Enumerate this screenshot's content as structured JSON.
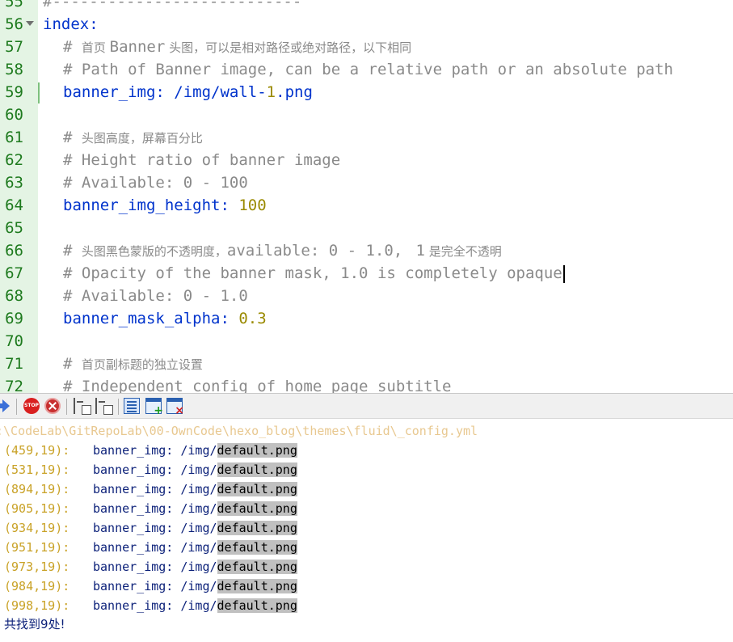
{
  "editor": {
    "lines": [
      {
        "num": "55",
        "kind": "plain",
        "text": "#---------------------------"
      },
      {
        "num": "56",
        "kind": "section",
        "text": "index:",
        "fold": true
      },
      {
        "num": "57",
        "kind": "comment",
        "prefix": "# ",
        "parts": [
          {
            "t": "首页 ",
            "cjk": true
          },
          {
            "t": "Banner",
            "cjk": false
          },
          {
            "t": " 头图，可以是相对路径或绝对路径，以下相同",
            "cjk": true
          }
        ]
      },
      {
        "num": "58",
        "kind": "comment",
        "prefix": "# ",
        "parts": [
          {
            "t": "Path of Banner image, can be a relative path or an absolute path",
            "cjk": false
          }
        ]
      },
      {
        "num": "59",
        "kind": "kv",
        "key": "banner_img",
        "value": "/img/wall-",
        "num_value": "1",
        "suffix": ".png"
      },
      {
        "num": "60",
        "kind": "blank"
      },
      {
        "num": "61",
        "kind": "comment",
        "prefix": "# ",
        "parts": [
          {
            "t": "头图高度，屏幕百分比",
            "cjk": true
          }
        ]
      },
      {
        "num": "62",
        "kind": "comment",
        "prefix": "# ",
        "parts": [
          {
            "t": "Height ratio of banner image",
            "cjk": false
          }
        ]
      },
      {
        "num": "63",
        "kind": "comment",
        "prefix": "# ",
        "parts": [
          {
            "t": "Available: 0 - 100",
            "cjk": false
          }
        ]
      },
      {
        "num": "64",
        "kind": "kv",
        "key": "banner_img_height",
        "value": "",
        "num_value": "100",
        "suffix": ""
      },
      {
        "num": "65",
        "kind": "blank"
      },
      {
        "num": "66",
        "kind": "comment",
        "prefix": "# ",
        "parts": [
          {
            "t": "头图黑色蒙版的不透明度，",
            "cjk": true
          },
          {
            "t": "available: 0 - 1.0, ",
            "cjk": false
          },
          {
            "t": " ",
            "cjk": true
          },
          {
            "t": "1",
            "cjk": false
          },
          {
            "t": " 是完全不透明",
            "cjk": true
          }
        ]
      },
      {
        "num": "67",
        "kind": "comment",
        "prefix": "# ",
        "caret": true,
        "parts": [
          {
            "t": "Opacity of the banner mask, 1.0 is completely opaque",
            "cjk": false
          }
        ]
      },
      {
        "num": "68",
        "kind": "comment",
        "prefix": "# ",
        "parts": [
          {
            "t": "Available: 0 - 1.0",
            "cjk": false
          }
        ]
      },
      {
        "num": "69",
        "kind": "kv",
        "key": "banner_mask_alpha",
        "value": "",
        "num_value": "0.3",
        "suffix": ""
      },
      {
        "num": "70",
        "kind": "blank"
      },
      {
        "num": "71",
        "kind": "comment",
        "prefix": "# ",
        "parts": [
          {
            "t": "首页副标题的独立设置",
            "cjk": true
          }
        ]
      },
      {
        "num": "72",
        "kind": "comment",
        "prefix": "# ",
        "parts": [
          {
            "t": "Independent config of home page subtitle",
            "cjk": false
          }
        ]
      }
    ]
  },
  "toolbar": {
    "buttons": [
      {
        "name": "goto-result-button",
        "icon": "arrow-icon"
      },
      {
        "name": "stop-search-button",
        "icon": "stop-icon",
        "label": "STOP"
      },
      {
        "name": "clear-results-button",
        "icon": "close-circle-icon"
      },
      {
        "name": "collapse-all-button",
        "icon": "collapse-tree-icon"
      },
      {
        "name": "expand-all-button",
        "icon": "expand-tree-icon"
      },
      {
        "name": "word-wrap-button",
        "icon": "list-icon"
      },
      {
        "name": "new-window-button",
        "icon": "window-add-icon"
      },
      {
        "name": "close-window-button",
        "icon": "window-close-icon"
      }
    ]
  },
  "results": {
    "file_path": ":\\CodeLab\\GitRepoLab\\00-OwnCode\\hexo_blog\\themes\\fluid\\_config.yml",
    "hits": [
      {
        "pos": "(459,19):",
        "before": "banner_img: /img/",
        "match": "default.png"
      },
      {
        "pos": "(531,19):",
        "before": "banner_img: /img/",
        "match": "default.png"
      },
      {
        "pos": "(894,19):",
        "before": "banner_img: /img/",
        "match": "default.png"
      },
      {
        "pos": "(905,19):",
        "before": "banner_img: /img/",
        "match": "default.png"
      },
      {
        "pos": "(934,19):",
        "before": "banner_img: /img/",
        "match": "default.png"
      },
      {
        "pos": "(951,19):",
        "before": "banner_img: /img/",
        "match": "default.png"
      },
      {
        "pos": "(973,19):",
        "before": "banner_img: /img/",
        "match": "default.png"
      },
      {
        "pos": "(984,19):",
        "before": "banner_img: /img/",
        "match": "default.png"
      },
      {
        "pos": "(998,19):",
        "before": "banner_img: /img/",
        "match": "default.png"
      }
    ],
    "summary": "共找到9处!"
  },
  "colors": {
    "gutter_bg": "#e4f4e4",
    "line_number": "#1e7a1e",
    "comment": "#8a8a8a",
    "key": "#0033cc",
    "number": "#9a8a00",
    "result_position": "#c9a227",
    "result_text": "#0a1f78",
    "match_highlight": "#c0c0c0"
  }
}
